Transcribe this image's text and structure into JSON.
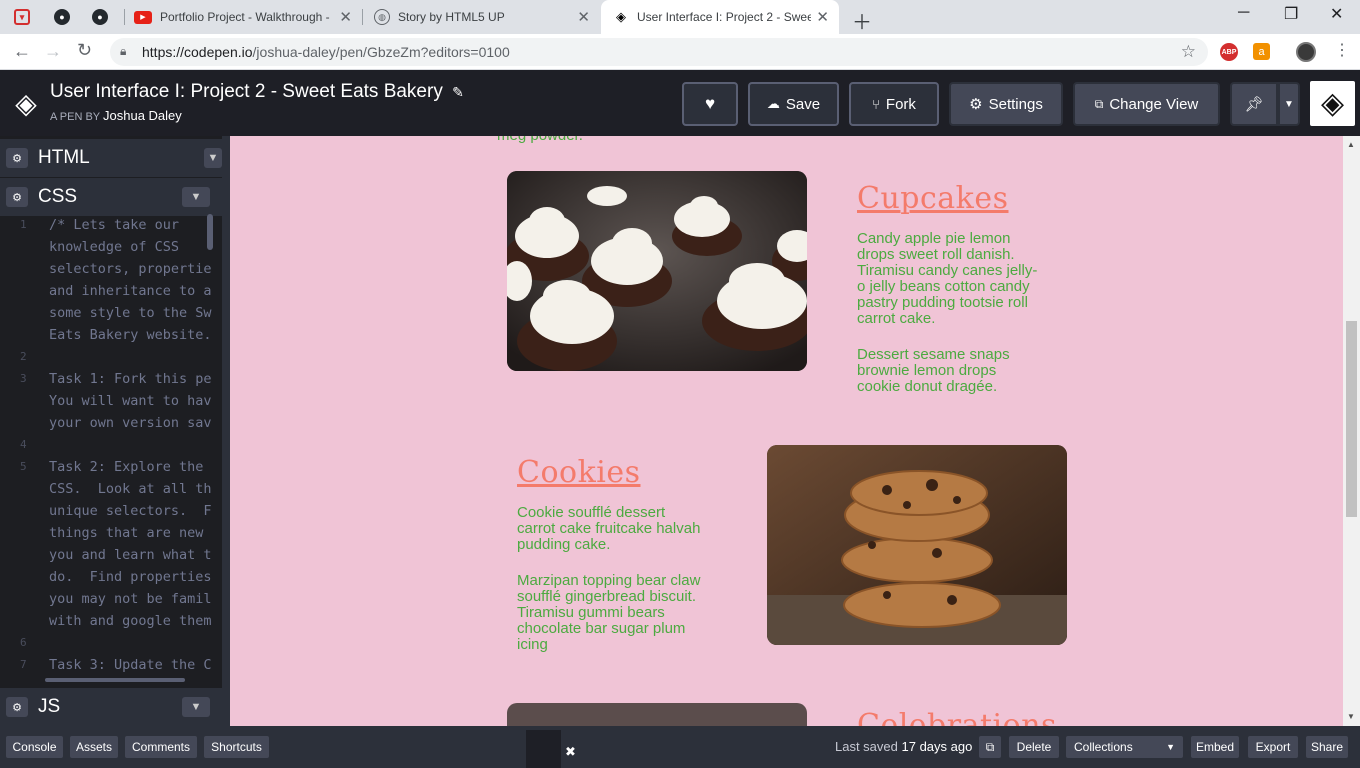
{
  "browser": {
    "tabs": [
      {
        "title": "Portfolio Project - Walkthrough -"
      },
      {
        "title": "Story by HTML5 UP"
      },
      {
        "title": "User Interface I: Project 2 - Sweet"
      }
    ],
    "url_domain": "https://codepen.io",
    "url_path": "/joshua-daley/pen/GbzeZm?editors=0100",
    "extension_abp": "ABP"
  },
  "codepen": {
    "pen_title": "User Interface I: Project 2 - Sweet Eats Bakery",
    "byline_prefix": "A PEN BY",
    "author": "Joshua Daley",
    "buttons": {
      "save": "Save",
      "fork": "Fork",
      "settings": "Settings",
      "change_view": "Change View"
    }
  },
  "editor": {
    "panels": {
      "html": "HTML",
      "css": "CSS",
      "js": "JS"
    },
    "code_lines": [
      {
        "n": "1",
        "text": "/* Lets take our"
      },
      {
        "n": "",
        "text": "knowledge of CSS"
      },
      {
        "n": "",
        "text": "selectors, propertie"
      },
      {
        "n": "",
        "text": "and inheritance to a"
      },
      {
        "n": "",
        "text": "some style to the Sw"
      },
      {
        "n": "",
        "text": "Eats Bakery website."
      },
      {
        "n": "2",
        "text": ""
      },
      {
        "n": "3",
        "text": "Task 1: Fork this pe"
      },
      {
        "n": "",
        "text": "You will want to hav"
      },
      {
        "n": "",
        "text": "your own version sav"
      },
      {
        "n": "4",
        "text": ""
      },
      {
        "n": "5",
        "text": "Task 2: Explore the"
      },
      {
        "n": "",
        "text": "CSS.  Look at all th"
      },
      {
        "n": "",
        "text": "unique selectors.  F"
      },
      {
        "n": "",
        "text": "things that are new "
      },
      {
        "n": "",
        "text": "you and learn what t"
      },
      {
        "n": "",
        "text": "do.  Find properties"
      },
      {
        "n": "",
        "text": "you may not be famil"
      },
      {
        "n": "",
        "text": "with and google them"
      },
      {
        "n": "6",
        "text": ""
      },
      {
        "n": "7",
        "text": "Task 3: Update the C"
      }
    ]
  },
  "preview": {
    "cut_text": "meg powder.",
    "cupcakes": {
      "title": "Cupcakes",
      "p1": [
        "Candy apple pie lemon",
        "drops sweet roll danish.",
        "Tiramisu candy canes jelly-",
        "o jelly beans cotton candy",
        "pastry pudding tootsie roll",
        "carrot cake."
      ],
      "p2": [
        "Dessert sesame snaps",
        "brownie lemon drops",
        "cookie donut dragée."
      ]
    },
    "cookies": {
      "title": "Cookies",
      "p1": [
        "Cookie soufflé dessert",
        "carrot cake fruitcake halvah",
        "pudding cake."
      ],
      "p2": [
        "Marzipan topping bear claw",
        "soufflé gingerbread biscuit.",
        "Tiramisu gummi bears",
        "chocolate bar sugar plum",
        "icing"
      ]
    },
    "celebrations": {
      "title": "Celebrations"
    }
  },
  "footer": {
    "console": "Console",
    "assets": "Assets",
    "comments": "Comments",
    "shortcuts": "Shortcuts",
    "last_saved_prefix": "Last saved",
    "last_saved_value": "17 days ago",
    "delete": "Delete",
    "collections": "Collections",
    "embed": "Embed",
    "export": "Export",
    "share": "Share"
  }
}
